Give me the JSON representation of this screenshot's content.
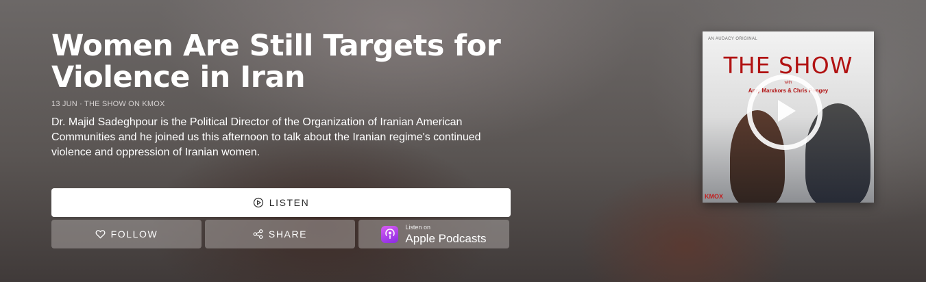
{
  "episode": {
    "title": "Women Are Still Targets for Violence in Iran",
    "meta": "13 JUN · THE SHOW ON KMOX",
    "description": "Dr. Majid Sadeghpour is the Political Director of the Organization of Iranian American Communities and he joined us this afternoon to talk about the Iranian regime's continued violence and oppression of Iranian women."
  },
  "actions": {
    "listen_label": "LISTEN",
    "follow_label": "FOLLOW",
    "share_label": "SHARE",
    "apple_small": "Listen on",
    "apple_big": "Apple Podcasts"
  },
  "cover": {
    "brand": "AN AUDACY ORIGINAL",
    "title": "THE SHOW",
    "with": "with",
    "hosts": "Amy Marxkors & Chris Pengey",
    "station": "KMOX"
  },
  "icons": {
    "listen": "play-circle-icon",
    "follow": "heart-icon",
    "share": "share-icon",
    "apple": "apple-podcasts-icon",
    "cover_play": "play-icon"
  },
  "colors": {
    "accent_red": "#b11212",
    "button_white": "#ffffff"
  }
}
